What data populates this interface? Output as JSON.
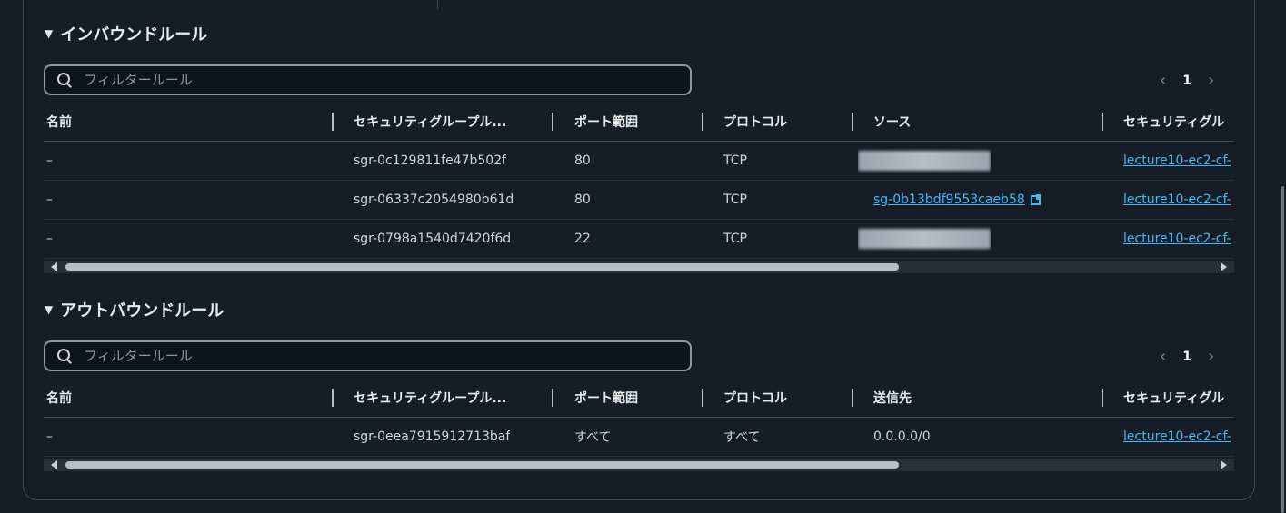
{
  "inbound": {
    "title": "インバウンドルール",
    "filter_placeholder": "フィルタールール",
    "page": "1",
    "columns": [
      "名前",
      "セキュリティグループル...",
      "ポート範囲",
      "プロトコル",
      "ソース",
      "セキュリティグル"
    ],
    "rows": [
      {
        "name": "–",
        "rule_id": "sgr-0c129811fe47b502f",
        "port": "80",
        "protocol": "TCP",
        "source": "",
        "source_redacted": true,
        "sg": "lecture10-ec2-cf-"
      },
      {
        "name": "–",
        "rule_id": "sgr-06337c2054980b61d",
        "port": "80",
        "protocol": "TCP",
        "source": "sg-0b13bdf9553caeb58",
        "source_redacted": false,
        "sg": "lecture10-ec2-cf-"
      },
      {
        "name": "–",
        "rule_id": "sgr-0798a1540d7420f6d",
        "port": "22",
        "protocol": "TCP",
        "source": "",
        "source_redacted": true,
        "sg": "lecture10-ec2-cf-"
      }
    ]
  },
  "outbound": {
    "title": "アウトバウンドルール",
    "filter_placeholder": "フィルタールール",
    "page": "1",
    "columns": [
      "名前",
      "セキュリティグループル...",
      "ポート範囲",
      "プロトコル",
      "送信先",
      "セキュリティグル"
    ],
    "rows": [
      {
        "name": "–",
        "rule_id": "sgr-0eea7915912713baf",
        "port": "すべて",
        "protocol": "すべて",
        "destination": "0.0.0.0/0",
        "sg": "lecture10-ec2-cf-"
      }
    ]
  },
  "colors": {
    "background": "#161d26",
    "link": "#44b9f6",
    "border": "#414d5c"
  }
}
